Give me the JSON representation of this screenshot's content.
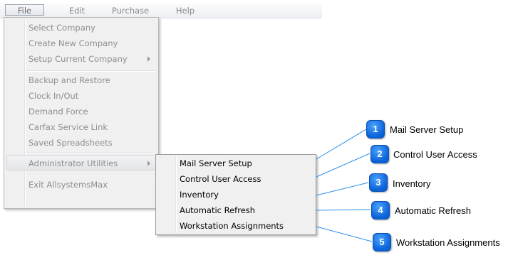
{
  "menubar": {
    "file": "File",
    "edit": "Edit",
    "purchase": "Purchase",
    "help": "Help"
  },
  "file_menu": {
    "items": [
      "Select Company",
      "Create New Company",
      "Setup Current Company",
      "Backup and Restore",
      "Clock In/Out",
      "Demand Force",
      "Carfax Service Link",
      "Saved Spreadsheets",
      "Administrator Utilities",
      "Exit AllsystemsMax"
    ]
  },
  "admin_submenu": {
    "items": [
      "Mail Server Setup",
      "Control User Access",
      "Inventory",
      "Automatic Refresh",
      "Workstation Assignments"
    ]
  },
  "callouts": [
    {
      "number": "1",
      "label": "Mail Server Setup"
    },
    {
      "number": "2",
      "label": "Control User Access"
    },
    {
      "number": "3",
      "label": "Inventory"
    },
    {
      "number": "4",
      "label": "Automatic Refresh"
    },
    {
      "number": "5",
      "label": "Workstation Assignments"
    }
  ],
  "colors": {
    "callout_badge": "#1473e6",
    "callout_line": "#2a8ee8",
    "disabled_text": "#8e8e8e"
  }
}
